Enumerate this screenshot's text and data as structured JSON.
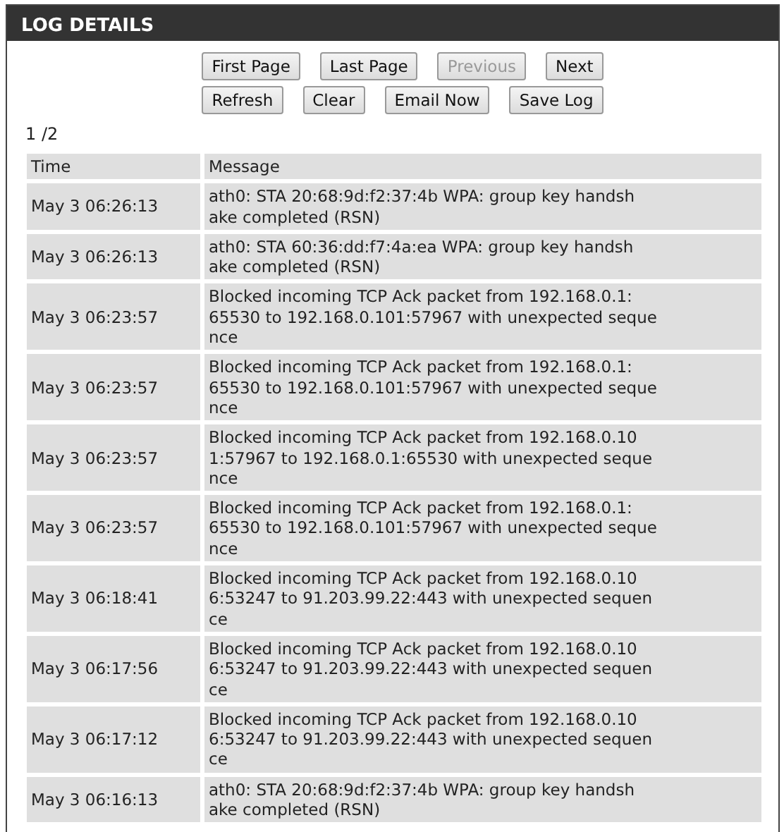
{
  "panel": {
    "title": "LOG DETAILS"
  },
  "button_rows": [
    [
      {
        "label": "First Page",
        "disabled": false
      },
      {
        "label": "Last Page",
        "disabled": false
      },
      {
        "label": "Previous",
        "disabled": true
      },
      {
        "label": "Next",
        "disabled": false
      }
    ],
    [
      {
        "label": "Refresh",
        "disabled": false
      },
      {
        "label": "Clear",
        "disabled": false
      },
      {
        "label": "Email Now",
        "disabled": false
      },
      {
        "label": "Save Log",
        "disabled": false
      }
    ]
  ],
  "page_indicator": "1 /2",
  "table": {
    "columns": [
      "Time",
      "Message"
    ],
    "rows": [
      {
        "time": "May 3 06:26:13",
        "message": [
          "ath0: STA 20:68:9d:f2:37:4b WPA: group key handsh",
          "ake completed (RSN)"
        ]
      },
      {
        "time": "May 3 06:26:13",
        "message": [
          "ath0: STA 60:36:dd:f7:4a:ea WPA: group key handsh",
          "ake completed (RSN)"
        ]
      },
      {
        "time": "May 3 06:23:57",
        "message": [
          "Blocked incoming TCP Ack packet from 192.168.0.1:",
          "65530 to 192.168.0.101:57967 with unexpected seque",
          "nce"
        ]
      },
      {
        "time": "May 3 06:23:57",
        "message": [
          "Blocked incoming TCP Ack packet from 192.168.0.1:",
          "65530 to 192.168.0.101:57967 with unexpected seque",
          "nce"
        ]
      },
      {
        "time": "May 3 06:23:57",
        "message": [
          "Blocked incoming TCP Ack packet from 192.168.0.10",
          "1:57967 to 192.168.0.1:65530 with unexpected seque",
          "nce"
        ]
      },
      {
        "time": "May 3 06:23:57",
        "message": [
          "Blocked incoming TCP Ack packet from 192.168.0.1:",
          "65530 to 192.168.0.101:57967 with unexpected seque",
          "nce"
        ]
      },
      {
        "time": "May 3 06:18:41",
        "message": [
          "Blocked incoming TCP Ack packet from 192.168.0.10",
          "6:53247 to 91.203.99.22:443 with unexpected sequen",
          "ce"
        ]
      },
      {
        "time": "May 3 06:17:56",
        "message": [
          "Blocked incoming TCP Ack packet from 192.168.0.10",
          "6:53247 to 91.203.99.22:443 with unexpected sequen",
          "ce"
        ]
      },
      {
        "time": "May 3 06:17:12",
        "message": [
          "Blocked incoming TCP Ack packet from 192.168.0.10",
          "6:53247 to 91.203.99.22:443 with unexpected sequen",
          "ce"
        ]
      },
      {
        "time": "May 3 06:16:13",
        "message": [
          "ath0: STA 20:68:9d:f2:37:4b WPA: group key handsh",
          "ake completed (RSN)"
        ]
      }
    ]
  }
}
